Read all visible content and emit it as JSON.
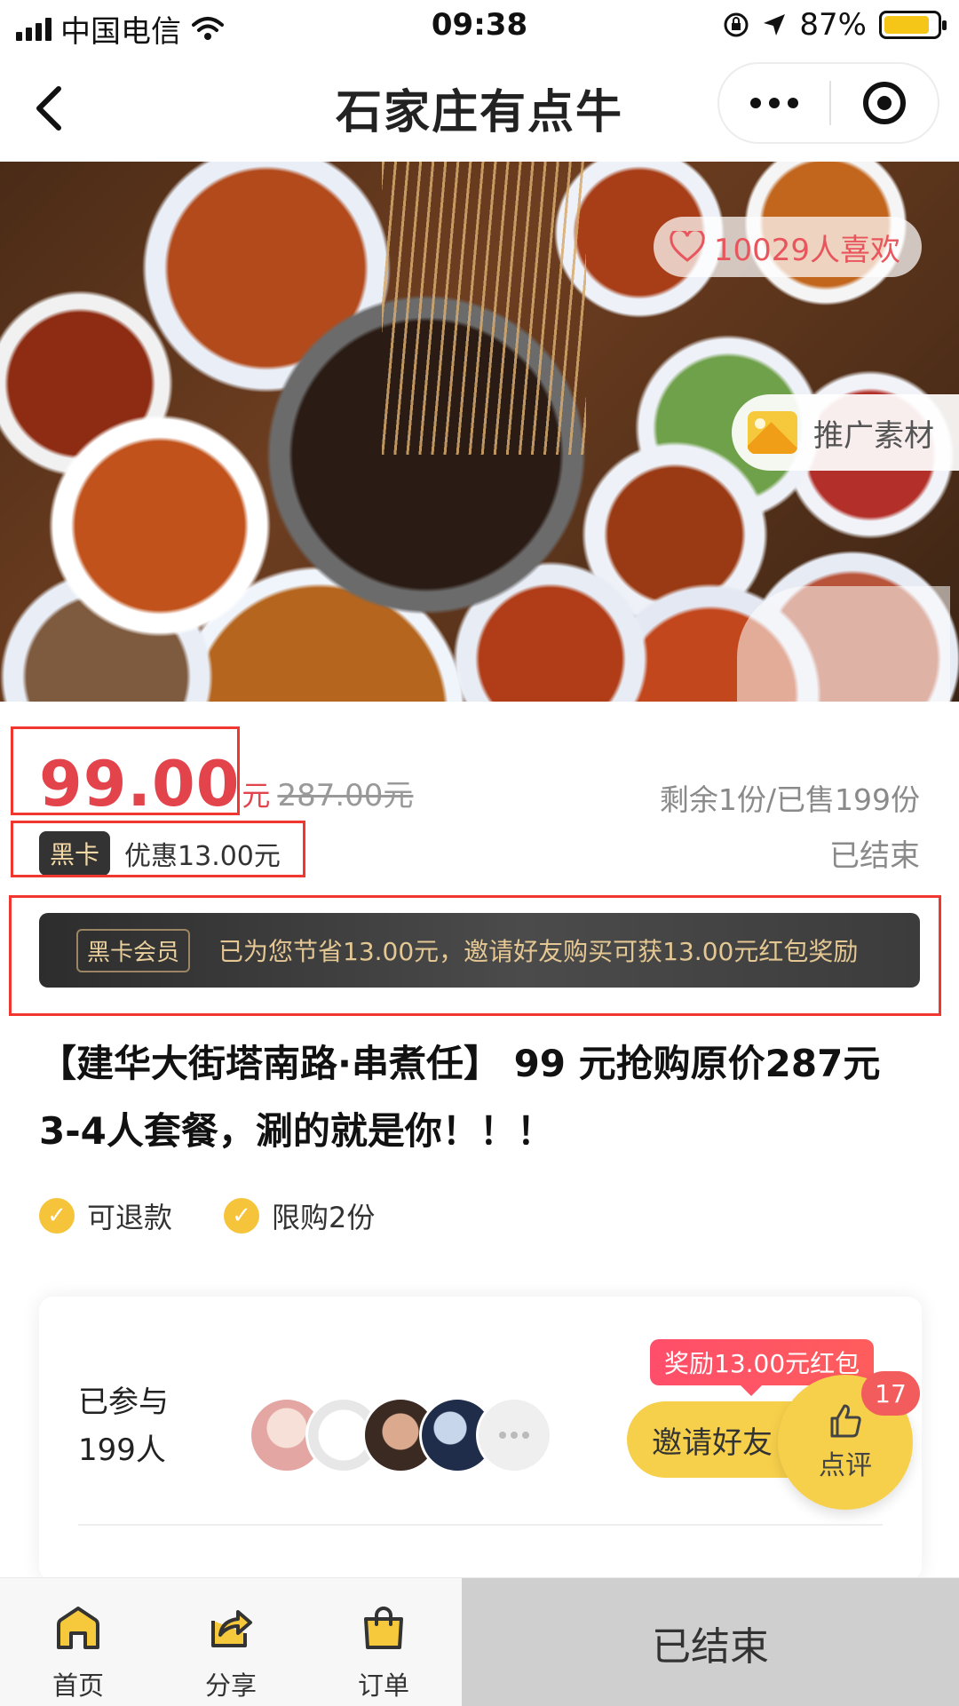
{
  "status_bar": {
    "carrier": "中国电信",
    "time": "09:38",
    "battery": "87%"
  },
  "nav": {
    "title": "石家庄有点牛"
  },
  "hero": {
    "likes": "10029人喜欢",
    "promo_material": "推广素材"
  },
  "price": {
    "current": "99.00",
    "unit": "元",
    "original": "287.00元",
    "stock": "剩余1份/已售199份"
  },
  "card": {
    "badge": "黑卡",
    "discount": "优惠13.00元",
    "status": "已结束"
  },
  "member_banner": {
    "tag": "黑卡会员",
    "text": "已为您节省13.00元，邀请好友购买可获13.00元红包奖励"
  },
  "deal": {
    "title": "【建华大街塔南路·串煮任】 99 元抢购原价287元3-4人套餐，涮的就是你！！！",
    "tags": [
      "可退款",
      "限购2份"
    ]
  },
  "participate": {
    "label_line1": "已参与",
    "label_line2": "199人",
    "reward": "奖励13.00元红包",
    "invite": "邀请好友"
  },
  "review": {
    "label": "点评",
    "count": "17"
  },
  "bottom_bar": {
    "tabs": [
      "首页",
      "分享",
      "订单"
    ],
    "action": "已结束"
  }
}
